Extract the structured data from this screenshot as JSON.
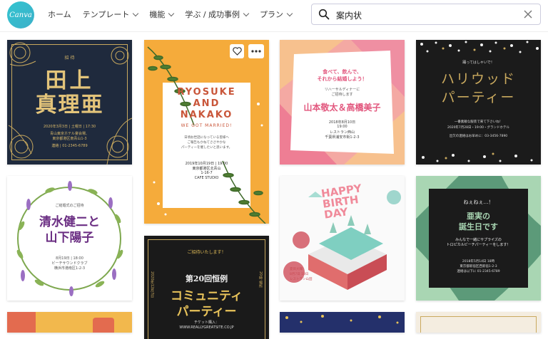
{
  "logo": "Canva",
  "nav": [
    "ホーム",
    "テンプレート",
    "機能",
    "学ぶ / 成功事例",
    "プラン"
  ],
  "search": {
    "value": "案内状",
    "placeholder": ""
  },
  "cards": {
    "c1": {
      "small_top": "招 待",
      "name1": "田上",
      "name2": "真理亜",
      "date": "2020年3月3日 | 土曜日 | 17:30",
      "venue1": "青山東京ホテル宴会場、",
      "venue2": "東京都港区南青山1-3",
      "contact": "連絡 | 01-2345-6789"
    },
    "c2": {
      "line1": "RYOSUKE",
      "line2": "AND",
      "line3": "NAKAKO",
      "sub": "WE GOT MARRIED!",
      "p1": "日頃お世話になっている皆様へ",
      "p2": "ご報告もかねてささやかな",
      "p3": "パーティーを催したいと思います。",
      "d1": "2019年10月19日 | 19:00",
      "d2": "東京都港区北青山",
      "d3": "1-16-7",
      "d4": "CAFE STUDIO"
    },
    "c3": {
      "h1": "食べて、飲んで、",
      "h2": "それから結婚しよう！",
      "s1": "リハーサルディナーに",
      "s2": "ご招待します",
      "names": "山本敬太＆高橋美子",
      "d1": "2018年8月10日",
      "d2": "19:00",
      "d3": "レストラン西山",
      "d4": "千葉県浦安市街1-2-3"
    },
    "c4": {
      "top": "踊ってはしゃいで！",
      "title1": "ハリウッド",
      "title2": "パーティー",
      "l1": "一番素敵な服装で来て下さいね！",
      "l2": "2020年7月28日・19:00・グランドホテル",
      "l3": "出欠の連絡はお早めに：03-3456-7890"
    },
    "c5": {
      "top": "ご結婚式のご招待",
      "name1": "清水健二と",
      "name2": "山下陽子",
      "l1": "8月19日 | 18:00",
      "l2": "ビーチサウンドクラブ",
      "l3": "横浜市港南区1-2-3"
    },
    "c6": {
      "top": "ご招待いたします！",
      "title1": "第20回恒例",
      "title2": "コミュニティ",
      "title3": "パーティー",
      "t1": "チケット購入：",
      "t2": "WWW.REALLYGREATSITE.CO.JP",
      "side1": "2020年12月7日",
      "side2": "20時",
      "side3": "場所"
    },
    "c7": {
      "h1": "HAPPY",
      "h2": "BIRTH",
      "h3": "DAY",
      "l1": "夏目大輝",
      "l2": "8月7日 10日",
      "l3": "レストラン山田"
    },
    "c8": {
      "top": "ねぇねぇ…！",
      "h1": "亜実の",
      "h2": "誕生日です",
      "l1": "みんなで一緒にサプライズの",
      "l2": "トロピカルビーチパーティーをします！",
      "l3": "2018年5月14日 18時",
      "l4": "東京都新宿区西新宿1-2-3",
      "l5": "連絡は以下に 01-2345-6789"
    }
  },
  "colors": {
    "accent": "#33c4d0",
    "gold": "#d8b86a",
    "navy": "#1f2a3d",
    "orange": "#f5ab3b",
    "pink": "#e2567d",
    "dark": "#1b1b1b",
    "green": "#4d8c6a",
    "purple": "#7d3e8e"
  }
}
